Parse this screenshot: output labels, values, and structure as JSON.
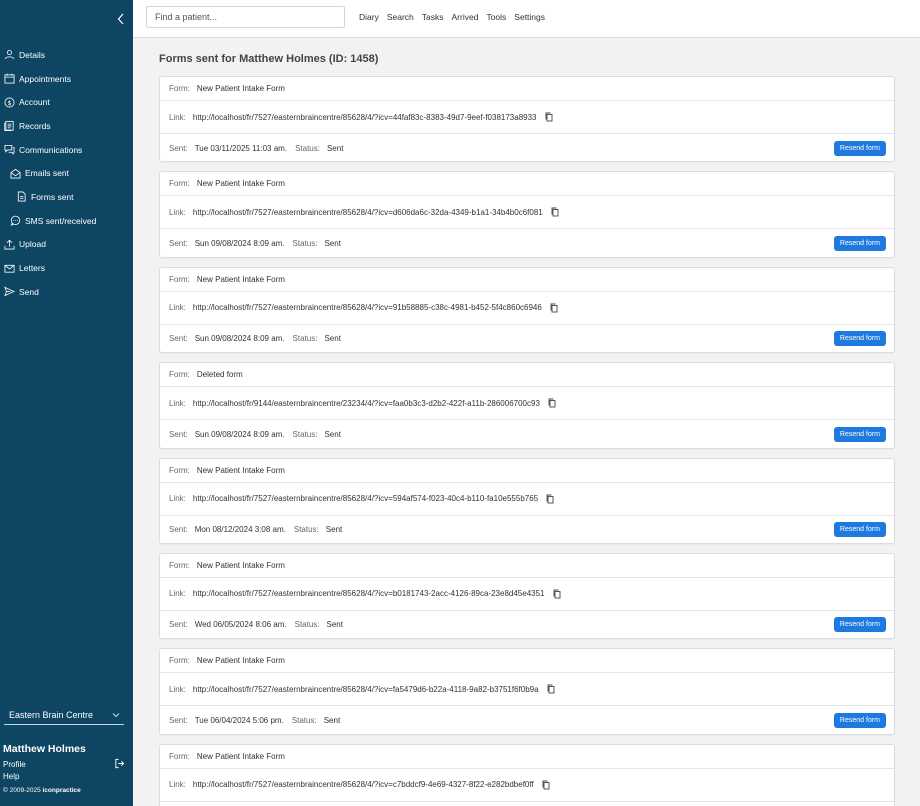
{
  "sidebar": {
    "items": [
      {
        "label": "Details",
        "icon": "person-icon",
        "level": 0
      },
      {
        "label": "Appointments",
        "icon": "calendar-icon",
        "level": 0
      },
      {
        "label": "Account",
        "icon": "dollar-icon",
        "level": 0
      },
      {
        "label": "Records",
        "icon": "records-icon",
        "level": 0
      },
      {
        "label": "Communications",
        "icon": "chat-icon",
        "level": 0
      },
      {
        "label": "Emails sent",
        "icon": "envelope-open-icon",
        "level": 1
      },
      {
        "label": "Forms sent",
        "icon": "document-icon",
        "level": 2
      },
      {
        "label": "SMS sent/received",
        "icon": "message-icon",
        "level": 1
      },
      {
        "label": "Upload",
        "icon": "upload-icon",
        "level": 0
      },
      {
        "label": "Letters",
        "icon": "envelope-icon",
        "level": 0
      },
      {
        "label": "Send",
        "icon": "send-icon",
        "level": 0
      }
    ],
    "clinic": "Eastern Brain Centre",
    "user_name": "Matthew Holmes",
    "profile_label": "Profile",
    "help_label": "Help",
    "copyright_prefix": "© 2009-2025 ",
    "copyright_brand": "iconpractice"
  },
  "topbar": {
    "search_placeholder": "Find a patient...",
    "nav": [
      "Diary",
      "Search",
      "Tasks",
      "Arrived",
      "Tools",
      "Settings"
    ]
  },
  "page": {
    "title": "Forms sent for Matthew Holmes (ID: 1458)",
    "form_label": "Form:",
    "link_label": "Link:",
    "sent_label": "Sent:",
    "status_label": "Status:",
    "resend_label": "Resend form"
  },
  "forms": [
    {
      "form": "New Patient Intake Form",
      "link": "http://localhost/fr/7527/easternbraincentre/85628/4/?icv=44faf83c-8383-49d7-9eef-f038173a8933",
      "sent": "Tue 03/11/2025 11:03 am.",
      "status": "Sent"
    },
    {
      "form": "New Patient Intake Form",
      "link": "http://localhost/fr/7527/easternbraincentre/85628/4/?icv=d606da6c-32da-4349-b1a1-34b4b0c6f081",
      "sent": "Sun 09/08/2024 8:09 am.",
      "status": "Sent"
    },
    {
      "form": "New Patient Intake Form",
      "link": "http://localhost/fr/7527/easternbraincentre/85628/4/?icv=91b58885-c38c-4981-b452-5f4c860c6946",
      "sent": "Sun 09/08/2024 8:09 am.",
      "status": "Sent"
    },
    {
      "form": "Deleted form",
      "link": "http://localhost/fr/9144/easternbraincentre/23234/4/?icv=faa0b3c3-d2b2-422f-a11b-286006700c93",
      "sent": "Sun 09/08/2024 8:09 am.",
      "status": "Sent"
    },
    {
      "form": "New Patient Intake Form",
      "link": "http://localhost/fr/7527/easternbraincentre/85628/4/?icv=594af574-f023-40c4-b110-fa10e555b765",
      "sent": "Mon 08/12/2024 3:08 am.",
      "status": "Sent"
    },
    {
      "form": "New Patient Intake Form",
      "link": "http://localhost/fr/7527/easternbraincentre/85628/4/?icv=b0181743-2acc-4126-89ca-23e8d45e4351",
      "sent": "Wed 06/05/2024 8:06 am.",
      "status": "Sent"
    },
    {
      "form": "New Patient Intake Form",
      "link": "http://localhost/fr/7527/easternbraincentre/85628/4/?icv=fa5479d6-b22a-4118-9a82-b3751f6f0b9a",
      "sent": "Tue 06/04/2024 5:06 pm.",
      "status": "Sent"
    },
    {
      "form": "New Patient Intake Form",
      "link": "http://localhost/fr/7527/easternbraincentre/85628/4/?icv=c7bddcf9-4e69-4327-8f22-e282bdbef0ff",
      "sent": "",
      "status": ""
    }
  ],
  "colors": {
    "sidebar_bg": "#0d4563",
    "accent": "#1f7adf"
  }
}
